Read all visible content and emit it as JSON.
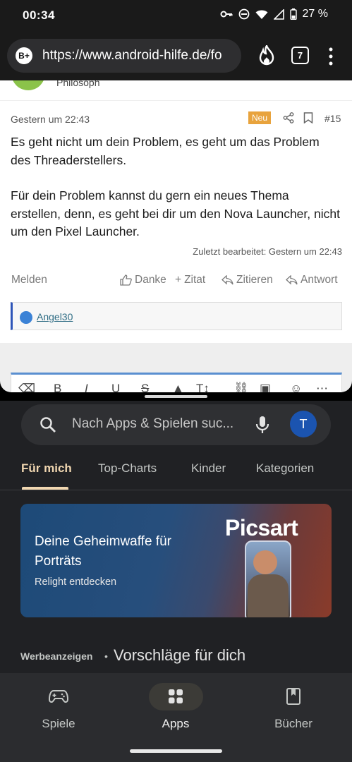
{
  "status": {
    "time": "00:34",
    "battery": "27 %"
  },
  "browser": {
    "url": "https://www.android-hilfe.de/fo",
    "tab_count": "7",
    "site_icon": "B+"
  },
  "post": {
    "author_role": "Philosoph",
    "date": "Gestern um 22:43",
    "badge": "Neu",
    "number": "#15",
    "paragraph1": "Es geht nicht um dein Problem, es geht um das Problem des Threaderstellers.",
    "paragraph2": "Für dein Problem kannst du gern ein neues Thema erstellen, denn, es geht bei dir um den Nova Launcher, nicht um den Pixel Launcher.",
    "edited": "Zuletzt bearbeitet: Gestern um 22:43",
    "actions": {
      "report": "Melden",
      "thanks": "Danke",
      "quote": "Zitat",
      "cite": "Zitieren",
      "reply": "Antwort"
    },
    "liked_by": "Angel30"
  },
  "editor": {
    "tools": [
      "B",
      "I",
      "U",
      "S",
      "T↕"
    ]
  },
  "playstore": {
    "search_placeholder": "Nach Apps & Spielen suc...",
    "avatar_letter": "T",
    "tabs": [
      "Für mich",
      "Top-Charts",
      "Kinder",
      "Kategorien"
    ],
    "banner": {
      "title": "Deine Geheimwaffe für Porträts",
      "subtitle": "Relight entdecken",
      "brand": "Picsart"
    },
    "section_prefix": "Werbeanzeigen",
    "section_title": "Vorschläge für dich",
    "nav": [
      "Spiele",
      "Apps",
      "Bücher"
    ]
  }
}
